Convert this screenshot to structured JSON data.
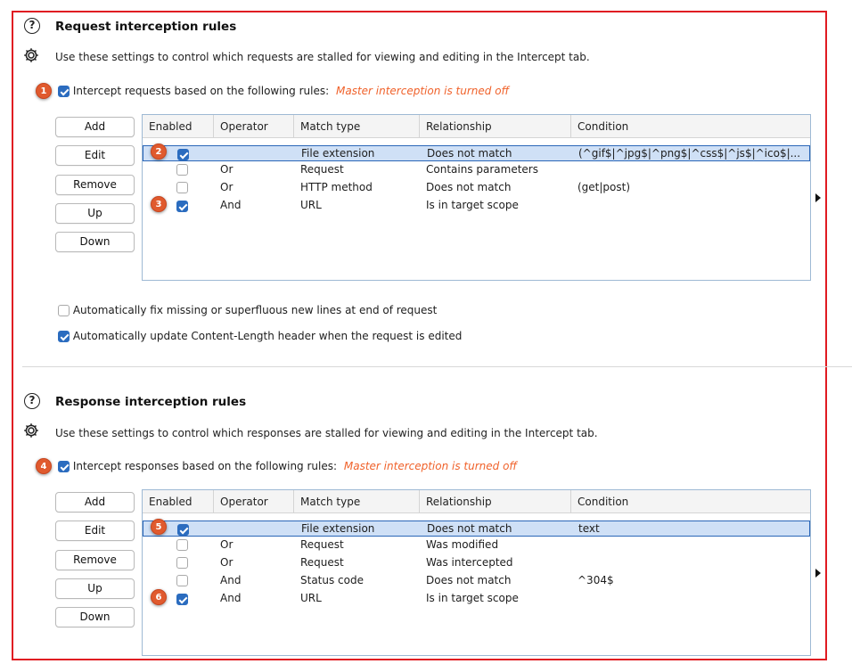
{
  "request": {
    "title": "Request interception rules",
    "description": "Use these settings to control which requests are stalled for viewing and editing in the Intercept tab.",
    "intercept_label": "Intercept requests based on the following rules:",
    "warning": "Master interception is turned off",
    "intercept_checked": true,
    "buttons": {
      "add": "Add",
      "edit": "Edit",
      "remove": "Remove",
      "up": "Up",
      "down": "Down"
    },
    "columns": [
      "Enabled",
      "Operator",
      "Match type",
      "Relationship",
      "Condition"
    ],
    "rows": [
      {
        "enabled": true,
        "operator": "",
        "match_type": "File extension",
        "relationship": "Does not match",
        "condition": "(^gif$|^jpg$|^png$|^css$|^js$|^ico$|...",
        "selected": true
      },
      {
        "enabled": false,
        "operator": "Or",
        "match_type": "Request",
        "relationship": "Contains parameters",
        "condition": ""
      },
      {
        "enabled": false,
        "operator": "Or",
        "match_type": "HTTP method",
        "relationship": "Does not match",
        "condition": "(get|post)"
      },
      {
        "enabled": true,
        "operator": "And",
        "match_type": "URL",
        "relationship": "Is in target scope",
        "condition": ""
      }
    ],
    "option_fix_newlines": "Automatically fix missing or superfluous new lines at end of request",
    "option_fix_newlines_checked": false,
    "option_update_length": "Automatically update Content-Length header when the request is edited",
    "option_update_length_checked": true
  },
  "response": {
    "title": "Response interception rules",
    "description": "Use these settings to control which responses are stalled for viewing and editing in the Intercept tab.",
    "intercept_label": "Intercept responses based on the following rules:",
    "warning": "Master interception is turned off",
    "intercept_checked": true,
    "buttons": {
      "add": "Add",
      "edit": "Edit",
      "remove": "Remove",
      "up": "Up",
      "down": "Down"
    },
    "columns": [
      "Enabled",
      "Operator",
      "Match type",
      "Relationship",
      "Condition"
    ],
    "rows": [
      {
        "enabled": true,
        "operator": "",
        "match_type": "File extension",
        "relationship": "Does not match",
        "condition": "text",
        "selected": true
      },
      {
        "enabled": false,
        "operator": "Or",
        "match_type": "Request",
        "relationship": "Was modified",
        "condition": ""
      },
      {
        "enabled": false,
        "operator": "Or",
        "match_type": "Request",
        "relationship": "Was intercepted",
        "condition": ""
      },
      {
        "enabled": false,
        "operator": "And",
        "match_type": "Status code",
        "relationship": "Does not match",
        "condition": "^304$"
      },
      {
        "enabled": true,
        "operator": "And",
        "match_type": "URL",
        "relationship": "Is in target scope",
        "condition": ""
      }
    ]
  },
  "markers": [
    "1",
    "2",
    "3",
    "4",
    "5",
    "6"
  ],
  "icons": {
    "help": "?",
    "settings": "gear-icon",
    "expand": "arrow-right-icon"
  },
  "colors": {
    "accent": "#2b6cbf",
    "warning": "#f0622b",
    "frame": "#e01b22",
    "marker": "#e05a2e"
  }
}
